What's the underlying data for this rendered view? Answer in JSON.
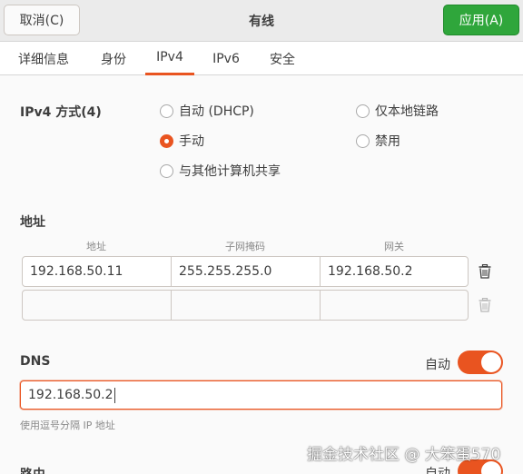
{
  "header": {
    "cancel_label": "取消(C)",
    "title": "有线",
    "apply_label": "应用(A)"
  },
  "tabs": [
    {
      "label": "详细信息"
    },
    {
      "label": "身份"
    },
    {
      "label": "IPv4",
      "active": true
    },
    {
      "label": "IPv6"
    },
    {
      "label": "安全"
    }
  ],
  "ipv4_method": {
    "label": "IPv4 方式(4)",
    "options": [
      {
        "label": "自动 (DHCP)",
        "checked": false
      },
      {
        "label": "仅本地链路",
        "checked": false
      },
      {
        "label": "手动",
        "checked": true
      },
      {
        "label": "禁用",
        "checked": false
      },
      {
        "label": "与其他计算机共享",
        "checked": false
      }
    ]
  },
  "addresses": {
    "label": "地址",
    "columns": [
      "地址",
      "子网掩码",
      "网关"
    ],
    "rows": [
      [
        "192.168.50.11",
        "255.255.255.0",
        "192.168.50.2"
      ],
      [
        "",
        "",
        ""
      ]
    ]
  },
  "dns": {
    "label": "DNS",
    "auto_label": "自动",
    "auto_on": true,
    "value": "192.168.50.2",
    "hint": "使用逗号分隔 IP 地址"
  },
  "routes": {
    "label": "路由",
    "auto_label": "自动",
    "auto_on": true
  },
  "watermark": "掘金技术社区 @ 大笨蛋570",
  "colors": {
    "accent": "#e95420",
    "apply": "#2fa63b"
  }
}
